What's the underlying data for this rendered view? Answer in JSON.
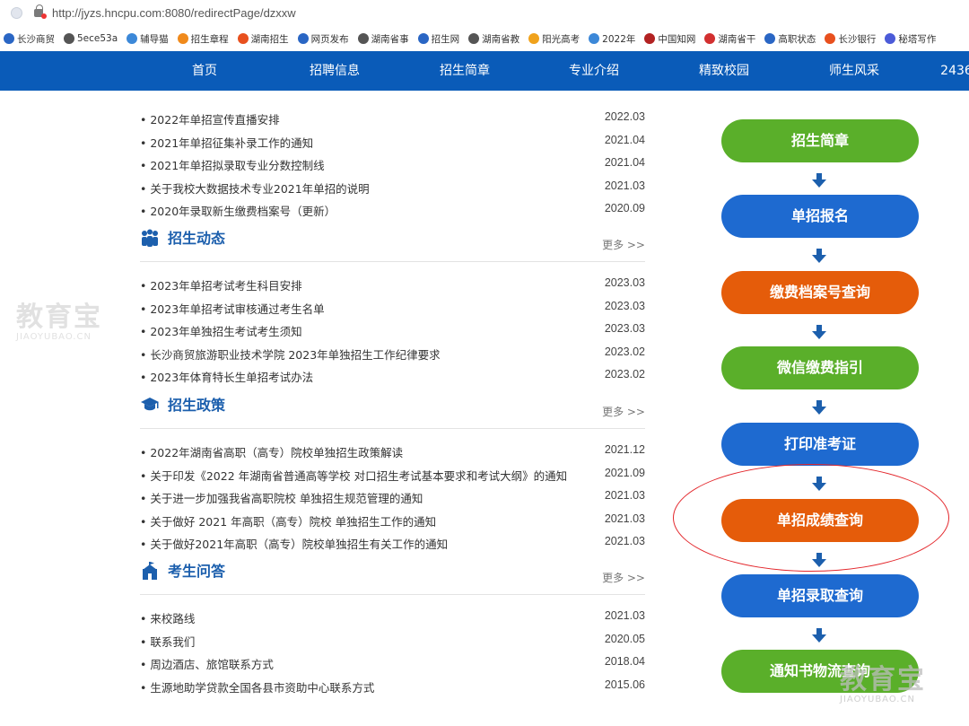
{
  "browser": {
    "url": "http://jyzs.hncpu.com:8080/redirectPage/dzxxw",
    "bookmarks": [
      {
        "label": "长沙商贸",
        "color": "#2a66c4"
      },
      {
        "label": "5ece53a",
        "color": "#555555"
      },
      {
        "label": "辅导猫",
        "color": "#3c88d8"
      },
      {
        "label": "招生章程",
        "color": "#f08a1c"
      },
      {
        "label": "湖南招生",
        "color": "#e8501e"
      },
      {
        "label": "网页发布",
        "color": "#2a66c4"
      },
      {
        "label": "湖南省事",
        "color": "#555555"
      },
      {
        "label": "招生网",
        "color": "#2a66c4"
      },
      {
        "label": "湖南省教",
        "color": "#555555"
      },
      {
        "label": "阳光高考",
        "color": "#f0a21c"
      },
      {
        "label": "2022年",
        "color": "#3c88d8"
      },
      {
        "label": "中国知网",
        "color": "#b22222"
      },
      {
        "label": "湖南省干",
        "color": "#d23030"
      },
      {
        "label": "高职状态",
        "color": "#2a66c4"
      },
      {
        "label": "长沙银行",
        "color": "#e8501e"
      },
      {
        "label": "秘塔写作",
        "color": "#4b5bd8"
      }
    ]
  },
  "nav": {
    "items": [
      "首页",
      "招聘信息",
      "招生简章",
      "专业介绍",
      "精致校园",
      "师生风采",
      "2436"
    ]
  },
  "top_list": [
    {
      "title": "2022年单招宣传直播安排",
      "date": "2022.03"
    },
    {
      "title": "2021年单招征集补录工作的通知",
      "date": "2021.04"
    },
    {
      "title": "2021年单招拟录取专业分数控制线",
      "date": "2021.04"
    },
    {
      "title": "关于我校大数据技术专业2021年单招的说明",
      "date": "2021.03"
    },
    {
      "title": "2020年录取新生缴费档案号（更新）",
      "date": "2020.09"
    }
  ],
  "sections": [
    {
      "title": "招生动态",
      "more": "更多 >>",
      "items": [
        {
          "title": "2023年单招考试考生科目安排",
          "date": "2023.03"
        },
        {
          "title": "2023年单招考试审核通过考生名单",
          "date": "2023.03"
        },
        {
          "title": "2023年单独招生考试考生须知",
          "date": "2023.03"
        },
        {
          "title": "长沙商贸旅游职业技术学院 2023年单独招生工作纪律要求",
          "date": "2023.02"
        },
        {
          "title": "2023年体育特长生单招考试办法",
          "date": "2023.02"
        }
      ]
    },
    {
      "title": "招生政策",
      "more": "更多 >>",
      "items": [
        {
          "title": "2022年湖南省高职（高专）院校单独招生政策解读",
          "date": "2021.12"
        },
        {
          "title": "关于印发《2022 年湖南省普通高等学校 对口招生考试基本要求和考试大纲》的通知",
          "date": "2021.09"
        },
        {
          "title": "关于进一步加强我省高职院校 单独招生规范管理的通知",
          "date": "2021.03"
        },
        {
          "title": "关于做好 2021 年高职（高专）院校 单独招生工作的通知",
          "date": "2021.03"
        },
        {
          "title": "关于做好2021年高职（高专）院校单独招生有关工作的通知",
          "date": "2021.03"
        }
      ]
    },
    {
      "title": "考生问答",
      "more": "更多 >>",
      "items": [
        {
          "title": "来校路线",
          "date": "2021.03"
        },
        {
          "title": "联系我们",
          "date": "2020.05"
        },
        {
          "title": "周边酒店、旅馆联系方式",
          "date": "2018.04"
        },
        {
          "title": "生源地助学贷款全国各县市资助中心联系方式",
          "date": "2015.06"
        }
      ]
    }
  ],
  "flow_buttons": [
    {
      "label": "招生简章",
      "color": "green"
    },
    {
      "label": "单招报名",
      "color": "blue"
    },
    {
      "label": "缴费档案号查询",
      "color": "orange"
    },
    {
      "label": "微信缴费指引",
      "color": "green"
    },
    {
      "label": "打印准考证",
      "color": "blue"
    },
    {
      "label": "单招成绩查询",
      "color": "orange"
    },
    {
      "label": "单招录取查询",
      "color": "blue"
    },
    {
      "label": "通知书物流查询",
      "color": "green"
    }
  ],
  "watermark": {
    "main": "教育宝",
    "sub": "JIAOYUBAO.CN"
  },
  "colors": {
    "nav": "#0a5bb8",
    "green": "#5aaf2a",
    "blue": "#1e6ad0",
    "orange": "#e55c0a",
    "highlight": "#e3262b"
  }
}
